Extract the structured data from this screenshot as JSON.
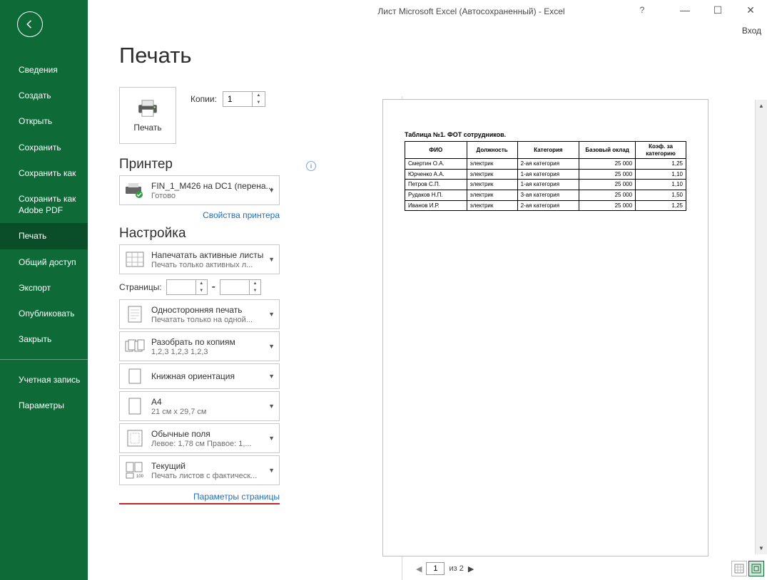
{
  "title": "Лист Microsoft Excel (Автосохраненный) - Excel",
  "login_label": "Вход",
  "sidebar": {
    "items": [
      {
        "label": "Сведения"
      },
      {
        "label": "Создать"
      },
      {
        "label": "Открыть"
      },
      {
        "label": "Сохранить"
      },
      {
        "label": "Сохранить как"
      },
      {
        "label": "Сохранить как Adobe PDF"
      },
      {
        "label": "Печать",
        "active": true
      },
      {
        "label": "Общий доступ"
      },
      {
        "label": "Экспорт"
      },
      {
        "label": "Опубликовать"
      },
      {
        "label": "Закрыть"
      }
    ],
    "footer": [
      {
        "label": "Учетная запись"
      },
      {
        "label": "Параметры"
      }
    ]
  },
  "print": {
    "heading": "Печать",
    "button_label": "Печать",
    "copies_label": "Копии:",
    "copies_value": "1",
    "printer_heading": "Принтер",
    "printer_name": "FIN_1_M426 на DC1 (перена...",
    "printer_status": "Готово",
    "printer_props": "Свойства принтера",
    "settings_heading": "Настройка",
    "pages_label": "Страницы:",
    "pages_sep": "-",
    "page_setup": "Параметры страницы",
    "options": {
      "scope": {
        "l1": "Напечатать активные листы",
        "l2": "Печать только активных л..."
      },
      "sides": {
        "l1": "Односторонняя печать",
        "l2": "Печатать только на одной..."
      },
      "collate": {
        "l1": "Разобрать по копиям",
        "l2": "1,2,3    1,2,3    1,2,3"
      },
      "orientation": {
        "l1": "Книжная ориентация",
        "l2": ""
      },
      "paper": {
        "l1": "A4",
        "l2": "21 см x 29,7 см"
      },
      "margins": {
        "l1": "Обычные поля",
        "l2": "Левое:  1,78 см    Правое:  1,..."
      },
      "scaling": {
        "l1": "Текущий",
        "l2": "Печать листов с фактическ..."
      }
    }
  },
  "pager": {
    "current": "1",
    "total_label": "из 2"
  },
  "chart_data": {
    "type": "table",
    "title": "Таблица №1. ФОТ сотрудников.",
    "columns": [
      "ФИО",
      "Должность",
      "Категория",
      "Базовый оклад",
      "Коэф. за категорию"
    ],
    "rows": [
      [
        "Смертин О.А.",
        "электрик",
        "2-ая категория",
        "25 000",
        "1,25"
      ],
      [
        "Юрченко А.А.",
        "электрик",
        "1-ая категория",
        "25 000",
        "1,10"
      ],
      [
        "Петров С.П.",
        "электрик",
        "1-ая категория",
        "25 000",
        "1,10"
      ],
      [
        "Рудаков Н.П.",
        "электрик",
        "3-ая категория",
        "25 000",
        "1,50"
      ],
      [
        "Иванов И.Р.",
        "электрик",
        "2-ая категория",
        "25 000",
        "1,25"
      ]
    ]
  }
}
